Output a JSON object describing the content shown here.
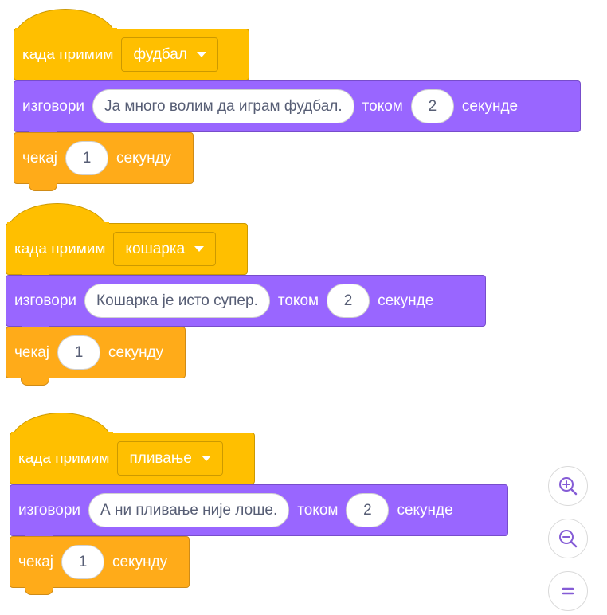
{
  "scripts": [
    {
      "hat": {
        "label": "када примим",
        "message": "фудбал"
      },
      "say": {
        "label": "изговори",
        "text": "Ја много волим да играм фудбал.",
        "for_label": "током",
        "secs": "2",
        "unit": "секунде"
      },
      "wait": {
        "label": "чекај",
        "secs": "1",
        "unit": "секунду"
      }
    },
    {
      "hat": {
        "label": "када примим",
        "message": "кошарка"
      },
      "say": {
        "label": "изговори",
        "text": "Кошарка је исто супер.",
        "for_label": "током",
        "secs": "2",
        "unit": "секунде"
      },
      "wait": {
        "label": "чекај",
        "secs": "1",
        "unit": "секунду"
      }
    },
    {
      "hat": {
        "label": "када примим",
        "message": "пливање"
      },
      "say": {
        "label": "изговори",
        "text": "А ни пливање није лоше.",
        "for_label": "током",
        "secs": "2",
        "unit": "секунде"
      },
      "wait": {
        "label": "чекај",
        "secs": "1",
        "unit": "секунду"
      }
    }
  ],
  "zoom_controls": {
    "zoom_in": "zoom-in-icon",
    "zoom_out": "zoom-out-icon",
    "reset": "reset-zoom-icon"
  },
  "colors": {
    "events": "#FFBF00",
    "looks": "#9966FF",
    "control": "#FFAB19"
  }
}
